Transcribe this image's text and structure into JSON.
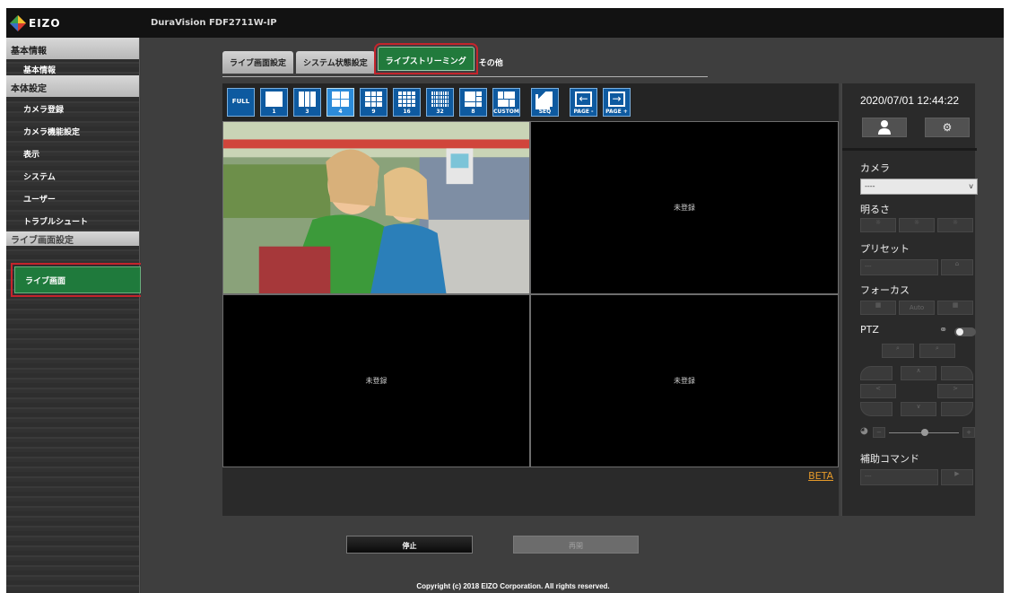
{
  "app": {
    "logo": "EIZO",
    "device_name": "DuraVision FDF2711W-IP"
  },
  "sidebar": {
    "sections": [
      {
        "title": "基本情報",
        "items": [
          "基本情報"
        ]
      },
      {
        "title": "本体設定",
        "items": [
          "カメラ登録",
          "カメラ機能設定",
          "表示",
          "システム",
          "ユーザー",
          "トラブルシュート"
        ]
      },
      {
        "title": "ライブ画面設定",
        "items": [
          "ライブ画面"
        ]
      }
    ],
    "active_item": "ライブ画面"
  },
  "tabs": [
    "ライブ画面設定",
    "システム状態設定",
    "ライブストリーミング",
    "その他"
  ],
  "active_tab": "ライブストリーミング",
  "toolbar": {
    "buttons": [
      {
        "icon": "full-icon",
        "label": "FULL"
      },
      {
        "icon": "layout-1-icon",
        "label": "1"
      },
      {
        "icon": "layout-3-icon",
        "label": "3"
      },
      {
        "icon": "layout-4-icon",
        "label": "4"
      },
      {
        "icon": "layout-9-icon",
        "label": "9"
      },
      {
        "icon": "layout-16-icon",
        "label": "16"
      },
      {
        "icon": "layout-32-icon",
        "label": "32"
      },
      {
        "icon": "layout-8-icon",
        "label": "8"
      },
      {
        "icon": "layout-custom-icon",
        "label": "CUSTOM"
      },
      {
        "icon": "sequence-icon",
        "label": "SEQ"
      },
      {
        "icon": "page-prev-icon",
        "label": "PAGE -"
      },
      {
        "icon": "page-next-icon",
        "label": "PAGE +"
      }
    ],
    "selected": "4"
  },
  "cells": [
    "",
    "未登録",
    "未登録",
    "未登録"
  ],
  "beta_link": "BETA",
  "panel": {
    "datetime": "2020/07/01 12:44:22",
    "camera_label": "カメラ",
    "camera_value": "----",
    "brightness_label": "明るさ",
    "preset_label": "プリセット",
    "preset_value": "---",
    "focus_label": "フォーカス",
    "focus_auto": "Auto",
    "ptz_label": "PTZ",
    "aux_label": "補助コマンド",
    "aux_value": "---"
  },
  "buttons": {
    "stop": "停止",
    "resume": "再開"
  },
  "footer": {
    "copyright": "Copyright (c) 2018 EIZO Corporation. All rights reserved."
  },
  "colors": {
    "accent_green": "#217a3c",
    "highlight_red": "#c4242b",
    "toolbar_blue": "#0e5aa0",
    "beta_orange": "#e59a2a"
  }
}
